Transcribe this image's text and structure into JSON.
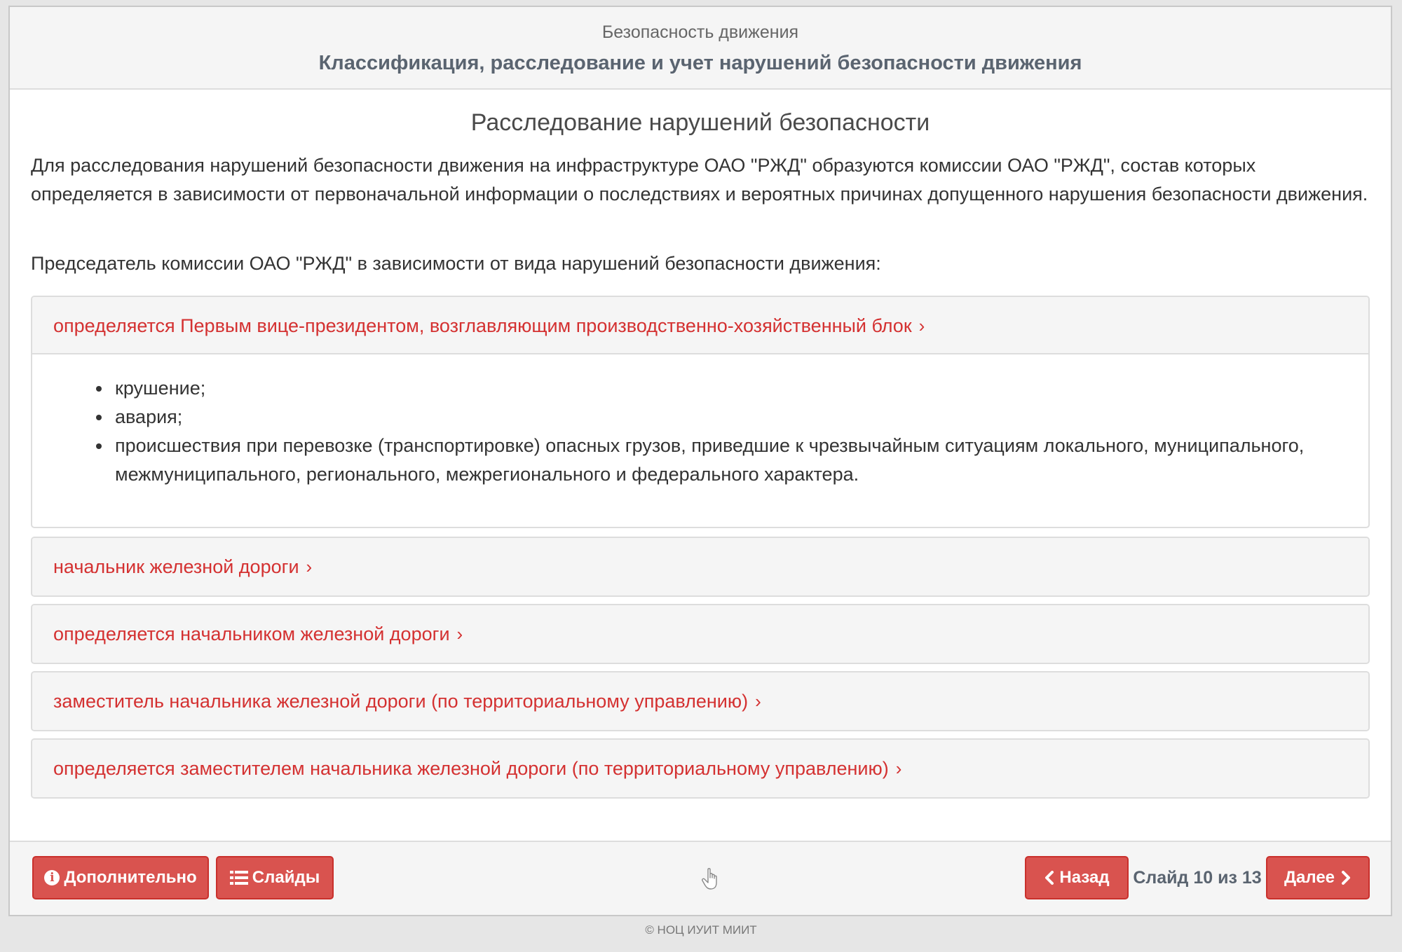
{
  "header": {
    "section": "Безопасность движения",
    "title": "Классификация, расследование и учет нарушений безопасности движения"
  },
  "slide": {
    "title": "Расследование нарушений безопасности",
    "intro": "Для расследования нарушений безопасности движения на инфраструктуре ОАО \"РЖД\" образуются комиссии ОАО \"РЖД\", состав которых определяется в зависимости от первоначальной информации о последствиях и вероятных причинах допущенного нарушения безопасности движения.",
    "lead": "Председатель комиссии ОАО \"РЖД\" в зависимости от вида нарушений безопасности движения:"
  },
  "accordion": [
    {
      "label": "определяется Первым вице-президентом, возглавляющим производственно-хозяйственный блок",
      "expanded": true,
      "items": [
        "крушение;",
        "авария;",
        "происшествия при перевозке (транспортировке) опасных грузов, приведшие к чрезвычайным ситуациям локального, муниципального, межмуниципального, регионального, межрегионального и федерального характера."
      ]
    },
    {
      "label": "начальник железной дороги",
      "expanded": false
    },
    {
      "label": "определяется начальником железной дороги",
      "expanded": false
    },
    {
      "label": "заместитель начальника железной дороги (по территориальному управлению)",
      "expanded": false
    },
    {
      "label": "определяется заместителем начальника железной дороги (по территориальному управлению)",
      "expanded": false
    }
  ],
  "footer": {
    "more_label": "Дополнительно",
    "slides_label": "Слайды",
    "back_label": "Назад",
    "counter": "Слайд 10 из 13",
    "next_label": "Далее"
  },
  "copyright": "© НОЦ ИУИТ МИИТ",
  "colors": {
    "accent": "#d9534f",
    "link": "#d43131",
    "panel_bg": "#f5f5f5",
    "border": "#dddddd"
  }
}
